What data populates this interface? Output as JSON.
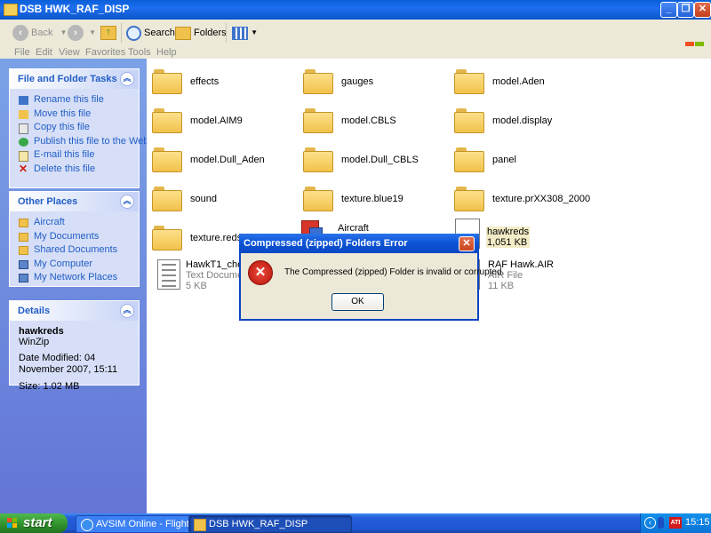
{
  "window": {
    "title": "DSB HWK_RAF_DISP",
    "controls": [
      "_",
      "❐",
      "✕"
    ]
  },
  "toolbar": {
    "back_label": "Back",
    "search_label": "Search",
    "folders_label": "Folders"
  },
  "menu": [
    "File",
    "Edit",
    "View",
    "Favorites",
    "Tools",
    "Help"
  ],
  "file_tasks": {
    "title": "File and Folder Tasks",
    "items": [
      "Rename this file",
      "Move this file",
      "Copy this file",
      "Publish this file to the Web",
      "E-mail this file",
      "Delete this file"
    ]
  },
  "other_places": {
    "title": "Other Places",
    "items": [
      "Aircraft",
      "My Documents",
      "Shared Documents",
      "My Computer",
      "My Network Places"
    ]
  },
  "details": {
    "title": "Details",
    "name": "hawkreds",
    "type": "WinZip",
    "modified": "Date Modified: 04 November 2007, 15:11",
    "size": "Size: 1.02 MB"
  },
  "files": {
    "folders": [
      "effects",
      "gauges",
      "model.Aden",
      "model.AIM9",
      "model.CBLS",
      "model.display",
      "model.Dull_Aden",
      "model.Dull_CBLS",
      "panel",
      "sound",
      "texture.blue19",
      "texture.prXX308_2000",
      "texture.reds"
    ],
    "aircraft": {
      "name": "Aircraft"
    },
    "hawkreds": {
      "name": "hawkreds",
      "size": "1,051 KB"
    },
    "hawkt1": {
      "name": "HawkT1_check",
      "type": "Text Document",
      "size": "5 KB"
    },
    "rafair": {
      "name": "RAF Hawk.AIR",
      "type": "AIR File",
      "size": "11 KB"
    }
  },
  "dialog": {
    "title": "Compressed (zipped) Folders Error",
    "message": "The Compressed (zipped) Folder is invalid or corrupted.",
    "ok_label": "OK"
  },
  "taskbar": {
    "start_label": "start",
    "tasks": [
      "AVSIM Online - Flight ...",
      "DSB HWK_RAF_DISP"
    ],
    "clock": "15:15"
  }
}
